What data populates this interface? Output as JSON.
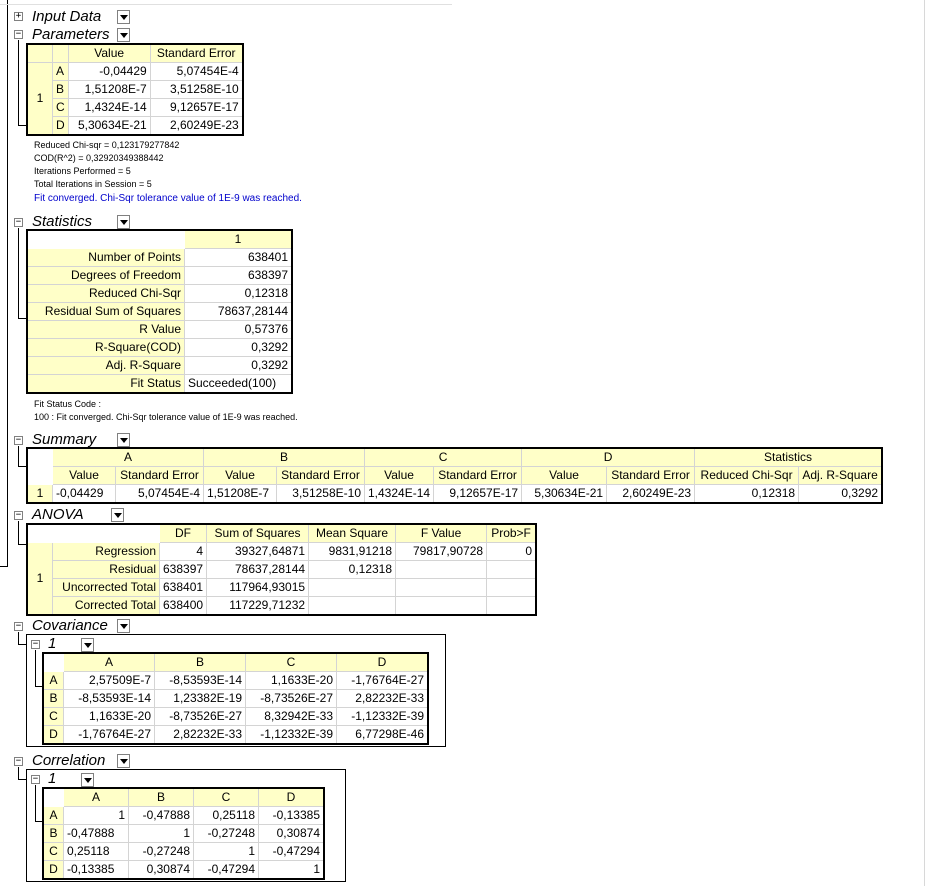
{
  "input_data": {
    "title": "Input Data"
  },
  "parameters": {
    "title": "Parameters",
    "headers": [
      "Value",
      "Standard Error"
    ],
    "row_group": "1",
    "rows": [
      {
        "name": "A",
        "value": "-0,04429",
        "se": "5,07454E-4"
      },
      {
        "name": "B",
        "value": "1,51208E-7",
        "se": "3,51258E-10"
      },
      {
        "name": "C",
        "value": "1,4324E-14",
        "se": "9,12657E-17"
      },
      {
        "name": "D",
        "value": "5,30634E-21",
        "se": "2,60249E-23"
      }
    ]
  },
  "fit_notes": {
    "chi": "Reduced Chi-sqr = 0,123179277842",
    "cod": "COD(R^2) = 0,32920349388442",
    "iter": "Iterations Performed = 5",
    "total": "Total Iterations in Session = 5",
    "converged": "Fit converged. Chi-Sqr tolerance value of 1E-9 was reached."
  },
  "statistics": {
    "title": "Statistics",
    "col": "1",
    "rows": [
      {
        "label": "Number of Points",
        "value": "638401"
      },
      {
        "label": "Degrees of Freedom",
        "value": "638397"
      },
      {
        "label": "Reduced Chi-Sqr",
        "value": "0,12318"
      },
      {
        "label": "Residual Sum of Squares",
        "value": "78637,28144"
      },
      {
        "label": "R Value",
        "value": "0,57376"
      },
      {
        "label": "R-Square(COD)",
        "value": "0,3292"
      },
      {
        "label": "Adj. R-Square",
        "value": "0,3292"
      },
      {
        "label": "Fit Status",
        "value": "Succeeded(100)"
      }
    ]
  },
  "status_notes": {
    "code": "Fit Status Code :",
    "msg": "100 : Fit converged. Chi-Sqr tolerance value of 1E-9 was reached."
  },
  "summary": {
    "title": "Summary",
    "groups": [
      "A",
      "B",
      "C",
      "D",
      "Statistics"
    ],
    "subheaders": [
      "Value",
      "Standard Error",
      "Value",
      "Standard Error",
      "Value",
      "Standard Error",
      "Value",
      "Standard Error",
      "Reduced Chi-Sqr",
      "Adj. R-Square"
    ],
    "row_label": "1",
    "values": [
      "-0,04429",
      "5,07454E-4",
      "1,51208E-7",
      "3,51258E-10",
      "1,4324E-14",
      "9,12657E-17",
      "5,30634E-21",
      "2,60249E-23",
      "0,12318",
      "0,3292"
    ]
  },
  "anova": {
    "title": "ANOVA",
    "headers": [
      "DF",
      "Sum of Squares",
      "Mean Square",
      "F Value",
      "Prob>F"
    ],
    "row_group": "1",
    "rows": [
      {
        "label": "Regression",
        "cells": [
          "4",
          "39327,64871",
          "9831,91218",
          "79817,90728",
          "0"
        ]
      },
      {
        "label": "Residual",
        "cells": [
          "638397",
          "78637,28144",
          "0,12318",
          "",
          ""
        ]
      },
      {
        "label": "Uncorrected Total",
        "cells": [
          "638401",
          "117964,93015",
          "",
          "",
          ""
        ]
      },
      {
        "label": "Corrected Total",
        "cells": [
          "638400",
          "117229,71232",
          "",
          "",
          ""
        ]
      }
    ]
  },
  "covariance": {
    "title": "Covariance",
    "sub": "1",
    "headers": [
      "A",
      "B",
      "C",
      "D"
    ],
    "rows": [
      {
        "name": "A",
        "cells": [
          "2,57509E-7",
          "-8,53593E-14",
          "1,1633E-20",
          "-1,76764E-27"
        ]
      },
      {
        "name": "B",
        "cells": [
          "-8,53593E-14",
          "1,23382E-19",
          "-8,73526E-27",
          "2,82232E-33"
        ]
      },
      {
        "name": "C",
        "cells": [
          "1,1633E-20",
          "-8,73526E-27",
          "8,32942E-33",
          "-1,12332E-39"
        ]
      },
      {
        "name": "D",
        "cells": [
          "-1,76764E-27",
          "2,82232E-33",
          "-1,12332E-39",
          "6,77298E-46"
        ]
      }
    ]
  },
  "correlation": {
    "title": "Correlation",
    "sub": "1",
    "headers": [
      "A",
      "B",
      "C",
      "D"
    ],
    "rows": [
      {
        "name": "A",
        "cells": [
          "1",
          "-0,47888",
          "0,25118",
          "-0,13385"
        ]
      },
      {
        "name": "B",
        "cells": [
          "-0,47888",
          "1",
          "-0,27248",
          "0,30874"
        ]
      },
      {
        "name": "C",
        "cells": [
          "0,25118",
          "-0,27248",
          "1",
          "-0,47294"
        ]
      },
      {
        "name": "D",
        "cells": [
          "-0,13385",
          "0,30874",
          "-0,47294",
          "1"
        ]
      }
    ]
  },
  "icons": {
    "expand": "plus-box-icon",
    "collapse": "minus-box-icon",
    "dropdown": "dropdown-arrow-icon"
  }
}
